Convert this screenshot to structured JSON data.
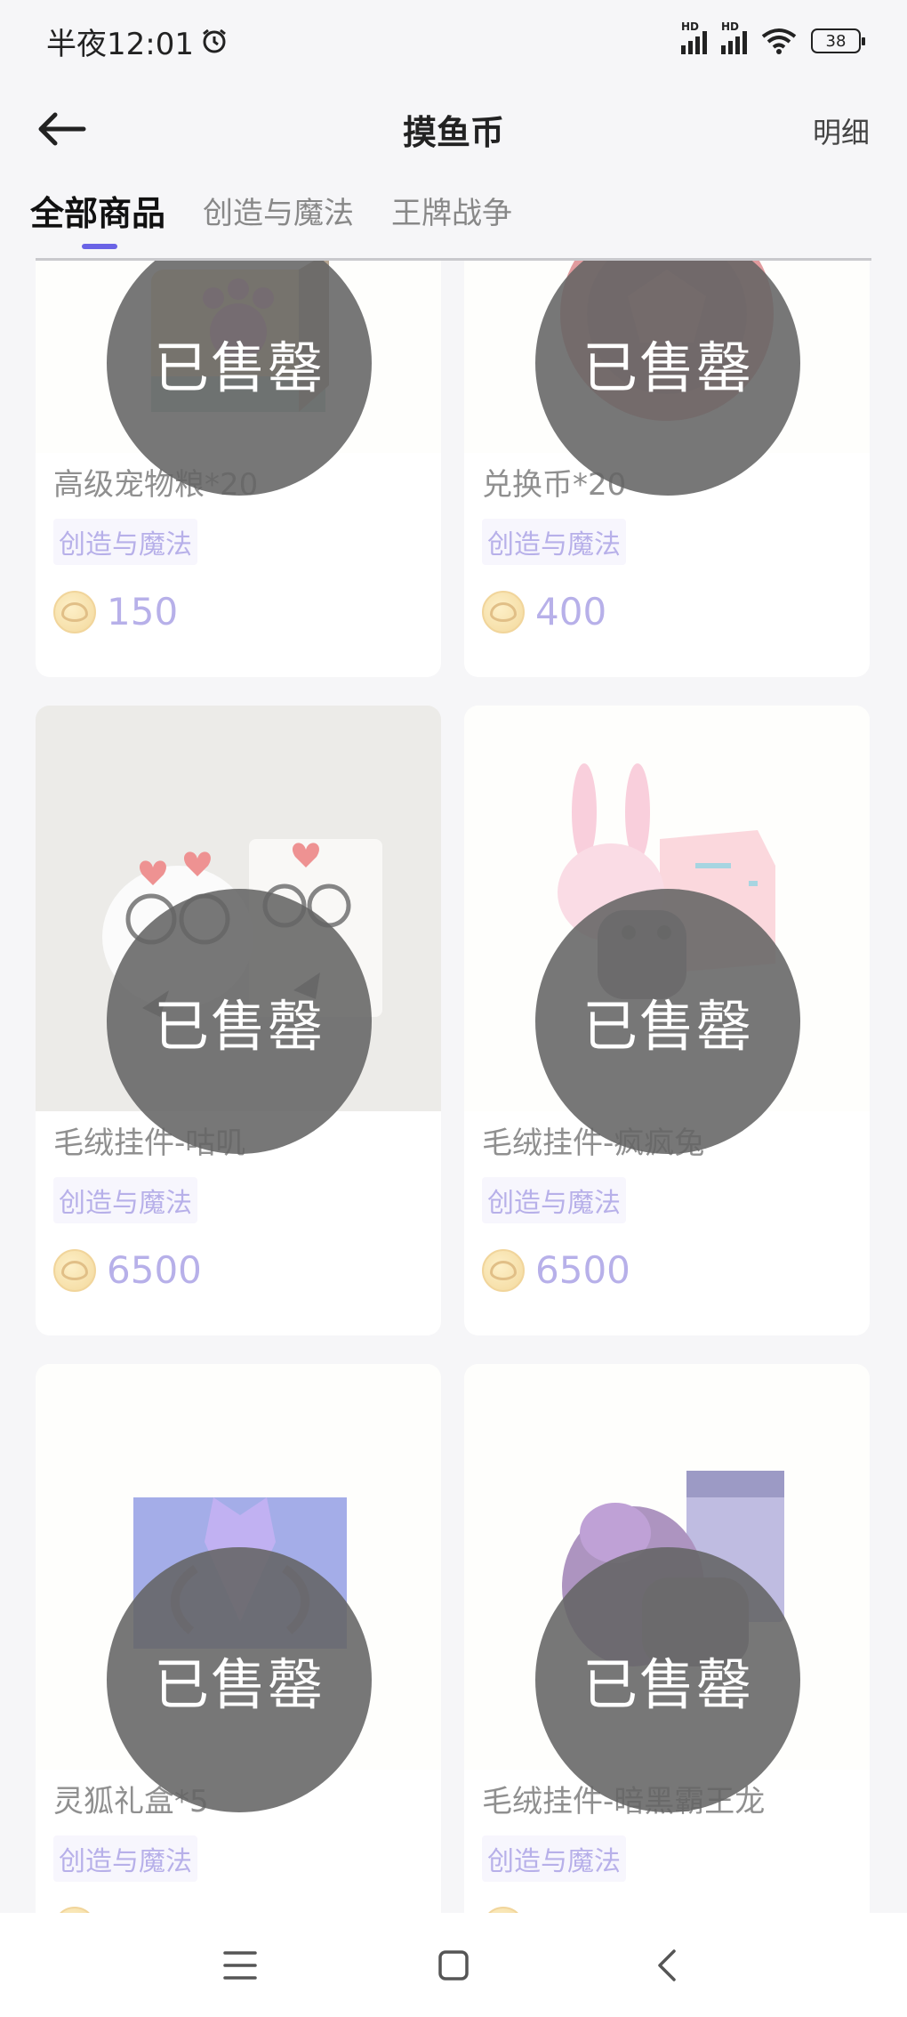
{
  "status_bar": {
    "time": "半夜12:01",
    "battery": "38",
    "signal_label": "HD"
  },
  "header": {
    "title": "摸鱼币",
    "detail_link": "明细"
  },
  "tabs": [
    {
      "label": "全部商品",
      "active": true
    },
    {
      "label": "创造与魔法",
      "active": false
    },
    {
      "label": "王牌战争",
      "active": false
    }
  ],
  "sold_out_label": "已售罄",
  "products": [
    {
      "name": "高级宠物粮*20",
      "tag": "创造与魔法",
      "price": "150",
      "image": "pet-food-box"
    },
    {
      "name": "兑换币*20",
      "tag": "创造与魔法",
      "price": "400",
      "image": "exchange-coin"
    },
    {
      "name": "毛绒挂件-咕叽",
      "tag": "创造与魔法",
      "price": "6500",
      "image": "plush-guji"
    },
    {
      "name": "毛绒挂件-疯疯兔",
      "tag": "创造与魔法",
      "price": "6500",
      "image": "plush-rabbit"
    },
    {
      "name": "灵狐礼盒*5",
      "tag": "创造与魔法",
      "price": "",
      "image": "fox-gift-box"
    },
    {
      "name": "毛绒挂件-暗黑霸王龙",
      "tag": "创造与魔法",
      "price": "",
      "image": "plush-dark-dragon"
    }
  ],
  "colors": {
    "accent": "#6a63e6",
    "tag_text": "#7d6fd8",
    "sold_badge": "#646464"
  },
  "nav_bar": {
    "icons": [
      "menu-icon",
      "home-icon",
      "back-icon"
    ]
  }
}
